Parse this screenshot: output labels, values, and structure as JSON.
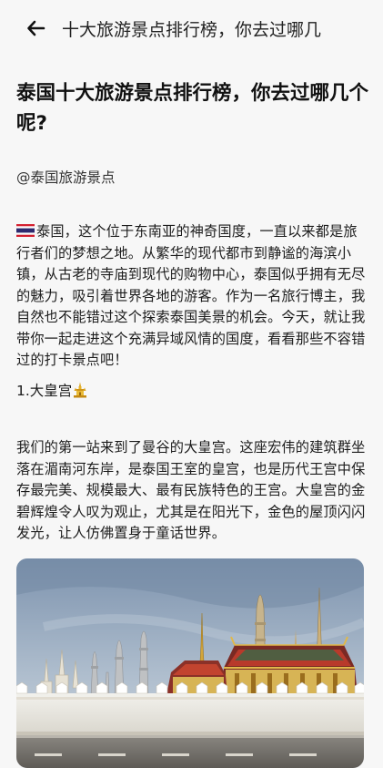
{
  "topbar": {
    "back_icon": "back-arrow-icon",
    "title": "十大旅游景点排行榜，你去过哪几"
  },
  "article": {
    "title": "泰国十大旅游景点排行榜，你去过哪几个呢?",
    "author": "@泰国旅游景点",
    "intro_flag_icon": "thailand-flag-icon",
    "intro": "泰国，这个位于东南亚的神奇国度，一直以来都是旅行者们的梦想之地。从繁华的现代都市到静谧的海滨小镇，从古老的寺庙到现代的购物中心，泰国似乎拥有无尽的魅力，吸引着世界各地的游客。作为一名旅行博主，我自然也不能错过这个探索泰国美景的机会。今天，就让我带你一起走进这个充满异域风情的国度，看看那些不容错过的打卡景点吧！",
    "section1": {
      "heading": "1.大皇宫",
      "heading_icon": "temple-icon",
      "body": "我们的第一站来到了曼谷的大皇宫。这座宏伟的建筑群坐落在湄南河东岸，是泰国王室的皇宫，也是历代王宫中保存最完美、规模最大、最有民族特色的王宫。大皇宫的金碧辉煌令人叹为观止，尤其是在阳光下，金色的屋顶闪闪发光，让人仿佛置身于童话世界。",
      "photo": "grand-palace-photo"
    }
  }
}
